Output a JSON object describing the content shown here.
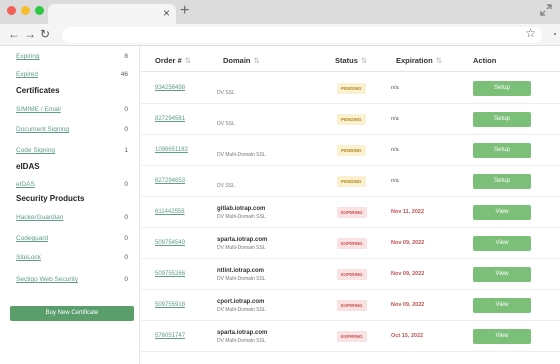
{
  "browser": {
    "tab_close": "×",
    "new_tab": "+",
    "back": "←",
    "forward": "→",
    "reload": "↻",
    "bookmark": "☆"
  },
  "sidebar": {
    "top_items": [
      {
        "label": "Expiring",
        "count": "8"
      },
      {
        "label": "Expired",
        "count": "46"
      }
    ],
    "certificates_heading": "Certificates",
    "certificates": [
      {
        "label": "S/MIME / Email",
        "count": "0"
      },
      {
        "label": "Document Signing",
        "count": "0"
      },
      {
        "label": "Code Signing",
        "count": "1"
      }
    ],
    "eidas_heading": "eIDAS",
    "eidas": [
      {
        "label": "eIDAS",
        "count": "0"
      }
    ],
    "security_heading": "Security Products",
    "security": [
      {
        "label": "HackerGuardian",
        "count": "0"
      },
      {
        "label": "Codeguard",
        "count": "0"
      },
      {
        "label": "SiteLock",
        "count": "0"
      },
      {
        "label": "Sectigo Web Security",
        "count": "0"
      }
    ],
    "buy_button": "Buy New Certificate"
  },
  "table": {
    "headers": {
      "order": "Order #",
      "domain": "Domain",
      "status": "Status",
      "expiration": "Expiration",
      "action": "Action"
    },
    "sort_glyph": "⇅",
    "rows": [
      {
        "order": "934256498",
        "domain": "",
        "type": "DV SSL",
        "status": "PENDING",
        "expiration": "n/a",
        "action": "Setup"
      },
      {
        "order": "827294581",
        "domain": "",
        "type": "DV SSL",
        "status": "PENDING",
        "expiration": "n/a",
        "action": "Setup"
      },
      {
        "order": "1096651182",
        "domain": "",
        "type": "DV Multi-Domain SSL",
        "status": "PENDING",
        "expiration": "n/a",
        "action": "Setup"
      },
      {
        "order": "827294653",
        "domain": "",
        "type": "DV SSL",
        "status": "PENDING",
        "expiration": "n/a",
        "action": "Setup"
      },
      {
        "order": "611442558",
        "domain": "gitlab.iotrap.com",
        "type": "DV Multi-Domain SSL",
        "status": "EXPIRING",
        "expiration": "Nov 11, 2022",
        "action": "View"
      },
      {
        "order": "509754540",
        "domain": "sparta.iotrap.com",
        "type": "DV Multi-Domain SSL",
        "status": "EXPIRING",
        "expiration": "Nov 09, 2022",
        "action": "View"
      },
      {
        "order": "509755266",
        "domain": "ntlint.iotrap.com",
        "type": "DV Multi-Domain SSL",
        "status": "EXPIRING",
        "expiration": "Nov 09, 2022",
        "action": "View"
      },
      {
        "order": "509755918",
        "domain": "cport.iotrap.com",
        "type": "DV Multi-Domain SSL",
        "status": "EXPIRING",
        "expiration": "Nov 09, 2022",
        "action": "View"
      },
      {
        "order": "576051747",
        "domain": "sparta.iotrap.com",
        "type": "DV Multi-Domain SSL",
        "status": "EXPIRING",
        "expiration": "Oct 15, 2022",
        "action": "View"
      }
    ]
  },
  "colors": {
    "accent": "#5a9e6c",
    "link": "#5f9e8a",
    "pending_bg": "#fbf0d0",
    "expiring_bg": "#fbe2e2"
  }
}
